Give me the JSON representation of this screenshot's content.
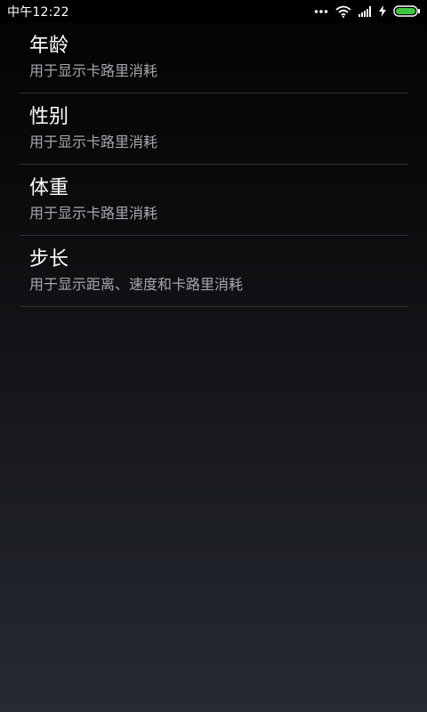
{
  "status_bar": {
    "time": "中午12:22",
    "icons": [
      "more-dots-icon",
      "wifi-icon",
      "signal-icon",
      "charging-icon",
      "battery-icon"
    ],
    "battery_color": "#3ec63e"
  },
  "preferences": [
    {
      "title": "年龄",
      "summary": "用于显示卡路里消耗"
    },
    {
      "title": "性别",
      "summary": "用于显示卡路里消耗"
    },
    {
      "title": "体重",
      "summary": "用于显示卡路里消耗"
    },
    {
      "title": "步长",
      "summary": "用于显示距离、速度和卡路里消耗"
    }
  ]
}
